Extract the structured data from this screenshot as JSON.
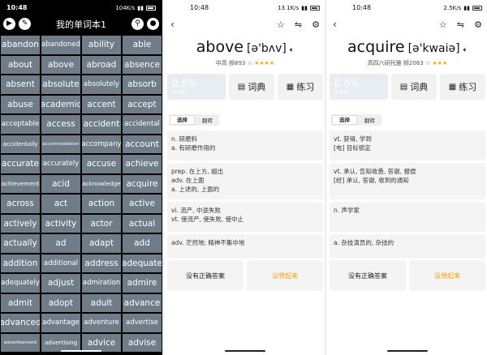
{
  "panel1": {
    "status": {
      "time": "10:48",
      "net": "104K/s"
    },
    "title": "我的单词本1",
    "words": [
      "abandon",
      "abandoned",
      "ability",
      "able",
      "about",
      "above",
      "abroad",
      "absence",
      "absent",
      "absolute",
      "absolutely",
      "absorb",
      "abuse",
      "academic",
      "accent",
      "accept",
      "acceptable",
      "access",
      "accident",
      "accidental",
      "accidentally",
      "accommodation",
      "accompany",
      "account",
      "accurate",
      "accurately",
      "accuse",
      "achieve",
      "achievement",
      "acid",
      "acknowledge",
      "acquire",
      "across",
      "act",
      "action",
      "active",
      "actively",
      "activity",
      "actor",
      "actual",
      "actually",
      "ad",
      "adapt",
      "add",
      "addition",
      "additional",
      "address",
      "adequate",
      "adequately",
      "adjust",
      "admiration",
      "admire",
      "admit",
      "adopt",
      "adult",
      "advance",
      "advanced",
      "advantage",
      "adventure",
      "advertise",
      "advertisement",
      "advertising",
      "advice",
      "advise"
    ]
  },
  "panel2": {
    "status": {
      "time": "10:48",
      "net": "13.1K/s"
    },
    "word": "above",
    "phonetic": "[ə'bʌv]",
    "meta_prefix": "中高  频893 ☆",
    "stars": "★★★★",
    "progress": {
      "percent": "0.0%",
      "sub": "未测试过"
    },
    "dict_label": "词典",
    "practice_label": "练习",
    "tabs": [
      "选择",
      "翻转"
    ],
    "defs": [
      [
        "n. 研磨料",
        "a. 有研磨作用的"
      ],
      [
        "prep. 在上方, 超出",
        "adv. 在上面",
        "a. 上述的, 上面的"
      ],
      [
        "vi. 流产, 中途失败",
        "vt. 使流产, 使失败, 使中止"
      ],
      [
        "adv. 茫然地; 精神不集中地"
      ]
    ],
    "no_answer": "没有正确答案",
    "forgot": "没想起来"
  },
  "panel3": {
    "status": {
      "time": "10:48",
      "net": "2.5K/s"
    },
    "word": "acquire",
    "phonetic": "[ə'kwaiə]",
    "meta_prefix": "高四六研托雅 频2063 ☆",
    "stars": "★★★",
    "progress": {
      "percent": "0.0%",
      "sub": "未测试过"
    },
    "dict_label": "词典",
    "practice_label": "练习",
    "tabs": [
      "选择",
      "翻转"
    ],
    "defs": [
      [
        "vt. 获得, 学到",
        "[电] 目标锁定"
      ],
      [
        "vt. 承认, 告知收悉, 答谢, 报偿",
        "[经] 承认, 答谢, 收到的通知"
      ],
      [
        "n. 声学家"
      ],
      [
        "a. 杂技演员的, 杂技的"
      ]
    ],
    "no_answer": "没有正确答案",
    "forgot": "没想起来"
  },
  "colors": {
    "tile": "#707d88",
    "accent": "#f39c12",
    "stars": "#f5a623"
  }
}
